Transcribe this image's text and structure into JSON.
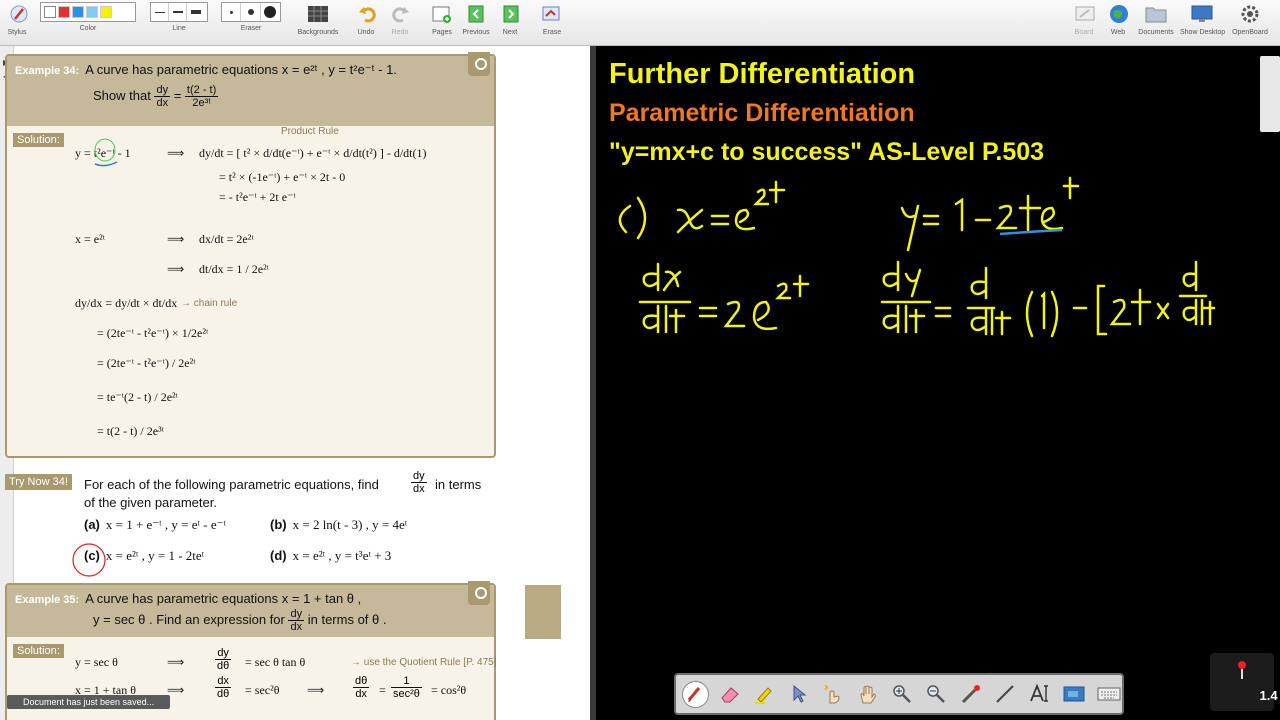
{
  "toolbar": {
    "stylus": "Stylus",
    "color": "Color",
    "line": "Line",
    "eraser": "Eraser",
    "backgrounds": "Backgrounds",
    "undo": "Undo",
    "redo": "Redo",
    "pages": "Pages",
    "previous": "Previous",
    "next": "Next",
    "erase": "Erase",
    "board": "Board",
    "web": "Web",
    "documents": "Documents",
    "show_desktop": "Show Desktop",
    "openboard": "OpenBoard",
    "swatch_colors": [
      "#ffffff",
      "#e53030",
      "#2f8fe6",
      "#7ecbf5",
      "#f5f100"
    ]
  },
  "example34": {
    "tag": "Example 34:",
    "prompt": "A curve has parametric equations x = e²ᵗ , y = t²e⁻ᵗ - 1.",
    "show_that": "Show that",
    "dydx": "dy",
    "dx": "dx",
    "rhs_num": "t(2 - t)",
    "rhs_den": "2e³ᵗ",
    "solution_tag": "Solution:",
    "product_rule": "Product Rule",
    "lines": [
      "y = t²e⁻ᵗ - 1",
      "⟹",
      "dy/dt = [ t² × d/dt(e⁻ᵗ) + e⁻ᵗ × d/dt(t²) ] - d/dt(1)",
      "= t² × (-1e⁻ᵗ) + e⁻ᵗ × 2t - 0",
      "= - t²e⁻ᵗ + 2t e⁻ᵗ",
      "x = e²ᵗ",
      "dx/dt = 2e²ᵗ",
      "dt/dx = 1 / 2e²ᵗ",
      "dy/dx = dy/dt × dt/dx",
      "→ chain rule",
      "= (2te⁻ᵗ - t²e⁻ᵗ) × 1/2e²ᵗ",
      "= (2te⁻ᵗ - t²e⁻ᵗ) / 2e²ᵗ",
      "= te⁻ᵗ(2 - t) / 2e²ᵗ",
      "= t(2 - t) / 2e³ᵗ"
    ]
  },
  "trynow": {
    "tag": "Try Now 34!",
    "text": "For each of the following parametric equations, find",
    "text2": "in terms",
    "text3": "of the given parameter.",
    "a_label": "(a)",
    "a": "x = 1 + e⁻ᵗ ,  y = eᵗ - e⁻ᵗ",
    "b_label": "(b)",
    "b": "x = 2 ln(t - 3) ,  y = 4eᵗ",
    "c_label": "(c)",
    "c": "x = e²ᵗ ,  y = 1 - 2teᵗ",
    "d_label": "(d)",
    "d": "x = e²ᵗ ,  y = t³eᵗ + 3"
  },
  "example35": {
    "tag": "Example 35:",
    "prompt": "A curve has parametric equations x = 1 + tan θ ,",
    "prompt2a": "y = sec θ .  Find an expression for",
    "prompt2b": "in terms of θ .",
    "dy": "dy",
    "dx": "dx",
    "solution_tag": "Solution:",
    "l1": "y = sec θ",
    "arrow": "⟹",
    "l1r_num": "dy",
    "l1r_den": "dθ",
    "l1r": "= sec θ tan θ",
    "quotient_note": "→ use the Quotient Rule [P. 475]",
    "l2": "x = 1 + tan θ",
    "l2r_num": "dx",
    "l2r_den": "dθ",
    "l2r": "= sec²θ",
    "l2rr_num": "dθ",
    "l2rr_den": "dx",
    "l2rr_a": "=",
    "l2rr_b": "1",
    "l2rr_c": "sec²θ",
    "l2rr_d": "= cos²θ"
  },
  "status": {
    "toast": "Document has just been saved..."
  },
  "board": {
    "title": "Further Differentiation",
    "subtitle": "Parametric Differentiation",
    "tagline": "\"y=mx+c to success\"  AS-Level P.503"
  },
  "zoom": {
    "level": "1.4 x"
  }
}
